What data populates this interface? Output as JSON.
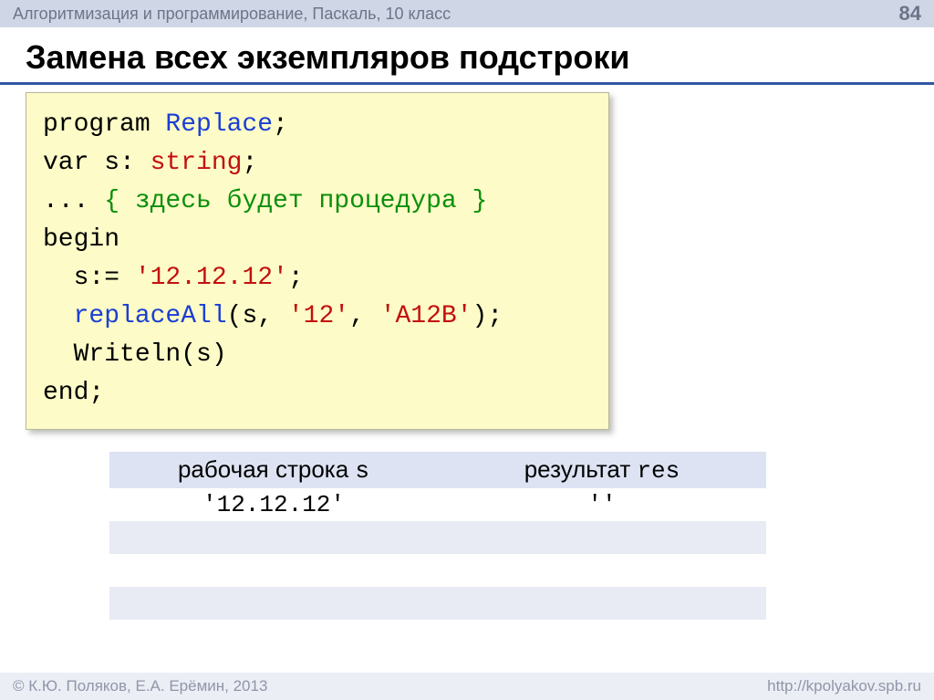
{
  "header": {
    "breadcrumb": "Алгоритмизация и программирование, Паскаль, 10 класс",
    "page_num": "84"
  },
  "title": "Замена всех экземпляров подстроки",
  "code": {
    "l1": {
      "a": "program ",
      "b": "Replace",
      "c": ";"
    },
    "l2": {
      "a": "var s: ",
      "b": "string",
      "c": ";"
    },
    "l3": {
      "a": "... ",
      "b": "{ здесь будет процедура }"
    },
    "l4": "begin",
    "l5": {
      "a": "  s:= ",
      "b": "'12.12.12'",
      "c": ";"
    },
    "l6": {
      "a": "  ",
      "b": "replaceAll",
      "c": "(s, ",
      "d": "'12'",
      "e": ", ",
      "f": "'A12B'",
      "g": ");"
    },
    "l7": "  Writeln(s)",
    "l8": "end;"
  },
  "table": {
    "h1a": "рабочая строка ",
    "h1b": "s",
    "h2a": "результат ",
    "h2b": "res",
    "r1c1": "'12.12.12'",
    "r1c2": "''"
  },
  "footer": {
    "left": "© К.Ю. Поляков, Е.А. Ерёмин, 2013",
    "right": "http://kpolyakov.spb.ru"
  }
}
